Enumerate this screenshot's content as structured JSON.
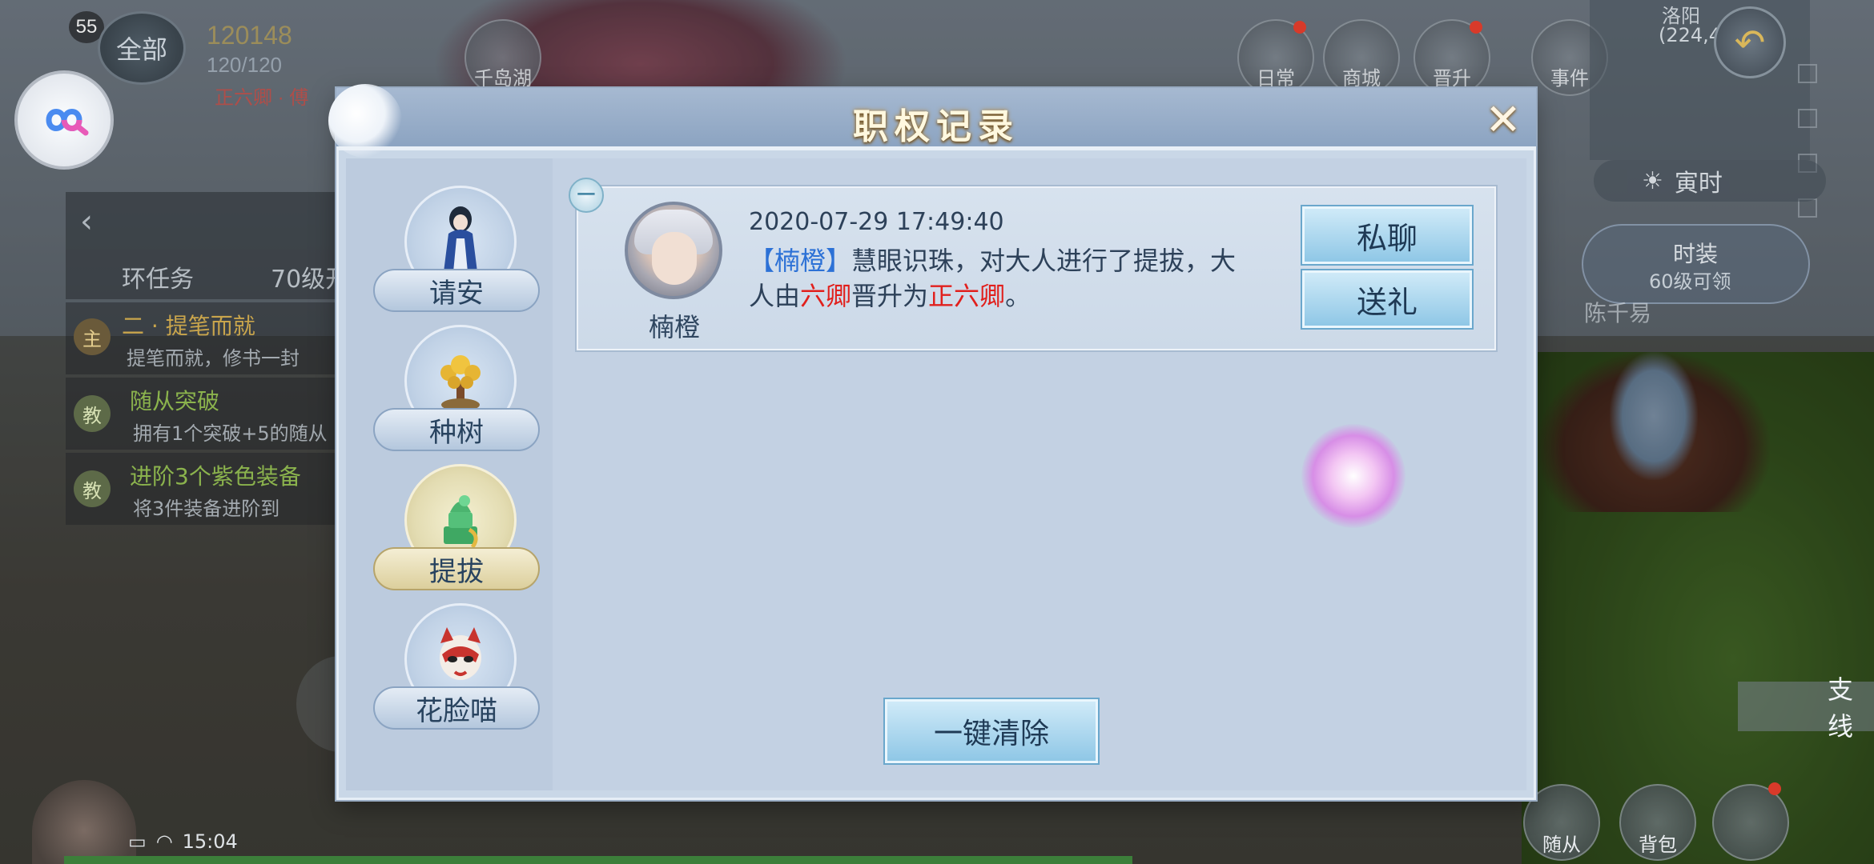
{
  "hud": {
    "level": "55",
    "all_label": "全部",
    "power": "120148",
    "hp": "120/120",
    "rank": "正六卿 · 傅",
    "tracker": {
      "row1_title": "环任务",
      "row1_level": "70级开",
      "row2_badge": "主",
      "row2_title": "二 · 提笔而就",
      "row2_sub": "提笔而就，修书一封",
      "row3_badge": "教",
      "row3_title": "随从突破",
      "row3_sub": "拥有1个突破+5的随从",
      "row4_badge": "教",
      "row4_title": "进阶3个紫色装备",
      "row4_sub": "将3件装备进阶到"
    },
    "time": "15:04",
    "top_icons": [
      "千岛湖",
      "日常",
      "商城",
      "晋升",
      "事件"
    ],
    "minimap": {
      "place": "洛阳",
      "coords": "(224,4"
    },
    "realtime": "寅时",
    "fashion": {
      "title": "时装",
      "sub": "60级可领"
    },
    "npc_name": "陈千易",
    "branch": "支线",
    "bottom_buttons": [
      "随从",
      "背包"
    ],
    "hp_fraction": 0.57
  },
  "dialog": {
    "title": "职权记录",
    "close_label": "✕",
    "tabs": [
      {
        "label": "请安",
        "icon": "kneeling-official-icon"
      },
      {
        "label": "种树",
        "icon": "money-tree-icon"
      },
      {
        "label": "提拔",
        "icon": "jade-seal-icon"
      },
      {
        "label": "花脸喵",
        "icon": "opera-mask-cat-icon"
      }
    ],
    "active_tab": "提拔",
    "collapse_label": "−",
    "record": {
      "avatar_name": "楠橙",
      "timestamp": "2020-07-29   17:49:40",
      "msg_bracket_open": "【",
      "msg_name": "楠橙",
      "msg_bracket_close": "】",
      "msg_part1": "慧眼识珠，对大人进行了提拔，大人由",
      "msg_from_rank": "六卿",
      "msg_part2": "晋升为",
      "msg_to_rank": "正六卿",
      "msg_end": "。",
      "chat_button": "私聊",
      "gift_button": "送礼"
    },
    "clear_button": "一键清除"
  },
  "colors": {
    "highlight_blue": "#2c71d6",
    "highlight_red": "#e1201d",
    "dialog_bg": "#c3d1e3",
    "title_gold": "#fff8df"
  }
}
